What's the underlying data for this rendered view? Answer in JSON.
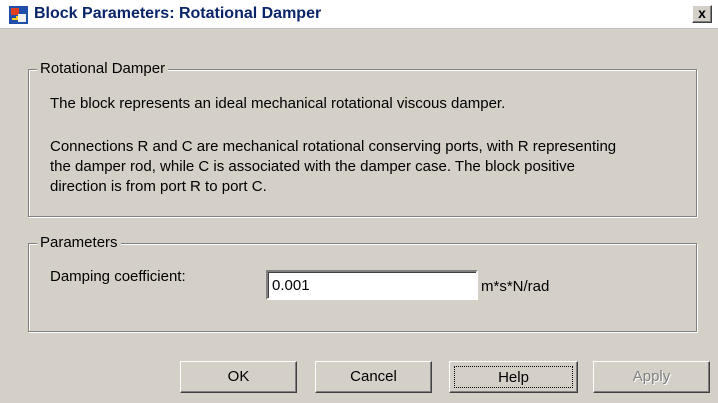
{
  "window": {
    "title": "Block Parameters: Rotational Damper",
    "close_label": "x"
  },
  "description_group": {
    "legend": "Rotational Damper",
    "summary": "The block represents an ideal mechanical rotational viscous damper.",
    "details": [
      "Connections R and C are mechanical rotational conserving ports, with R representing",
      "the damper rod, while C is associated with the damper case. The block positive",
      "direction is from port R to port C."
    ]
  },
  "parameters_group": {
    "legend": "Parameters",
    "damping": {
      "label": "Damping coefficient:",
      "value": "0.001",
      "unit": "m*s*N/rad"
    }
  },
  "buttons": {
    "ok": "OK",
    "cancel": "Cancel",
    "help": "Help",
    "apply": "Apply"
  },
  "colors": {
    "dialog_background": "#d4d0c8",
    "title_text": "#0a246a",
    "disabled_text": "#808080"
  },
  "icons": {
    "app": "simulink-block-icon",
    "close": "close-icon"
  },
  "states": {
    "apply_enabled": false,
    "focused_button": "help"
  }
}
